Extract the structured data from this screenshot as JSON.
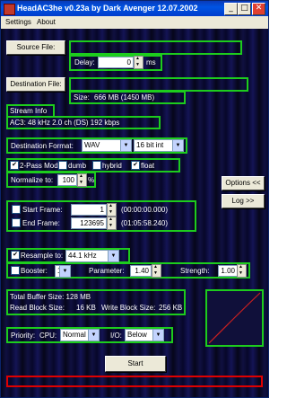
{
  "window": {
    "title": "HeadAC3he v0.23a by Dark Avenger 12.07.2002",
    "controls": {
      "minimize": "_",
      "maximize": "□",
      "close": "✕"
    }
  },
  "menu": [
    "Settings",
    "About"
  ],
  "source": {
    "button": "Source File:",
    "value": "",
    "delay_label": "Delay:",
    "delay_value": "0",
    "delay_unit": "ms"
  },
  "destination": {
    "button": "Destination File:",
    "value": "",
    "size_label": "Size:",
    "size_value": "666 MB (1450 MB)"
  },
  "stream": {
    "title": "Stream Info",
    "info": "AC3: 48 kHz  2.0 ch (DS)  192 kbps"
  },
  "format": {
    "label": "Destination Format:",
    "format_value": "WAV",
    "bits_value": "16 bit int"
  },
  "twopass": {
    "label": "2-Pass Mode:",
    "checked": true,
    "opt_dumb": "dumb",
    "opt_hybrid": "hybrid",
    "opt_float": "float",
    "float_checked": true
  },
  "normalize": {
    "label": "Normalize to:",
    "value": "100",
    "unit": "%"
  },
  "side_buttons": {
    "options": "Options <<",
    "log": "Log >>"
  },
  "frames": {
    "start_label": "Start Frame:",
    "start_value": "1",
    "start_time": "(00:00:00.000)",
    "end_label": "End Frame:",
    "end_value": "123695",
    "end_time": "(01:05:58.240)"
  },
  "resample": {
    "label": "Resample to:",
    "checked": true,
    "value": "44.1 kHz"
  },
  "booster": {
    "label": "Booster:",
    "checked": false,
    "select_value": "1",
    "param_label": "Parameter:",
    "param_value": "1.40",
    "strength_label": "Strength:",
    "strength_value": "1.00"
  },
  "buffers": {
    "total": "Total Buffer Size:  128 MB",
    "read": "Read Block Size:",
    "read_value": "16 KB",
    "write": "Write Block Size:",
    "write_value": "256 KB"
  },
  "priority": {
    "label": "Priority:",
    "cpu_label": "CPU:",
    "cpu_value": "Normal",
    "io_label": "I/O:",
    "io_value": "Below"
  },
  "start_button": "Start",
  "colors": {
    "group_border": "#1dcc1d",
    "status_border": "#e00000",
    "curve": "#cc2020"
  }
}
